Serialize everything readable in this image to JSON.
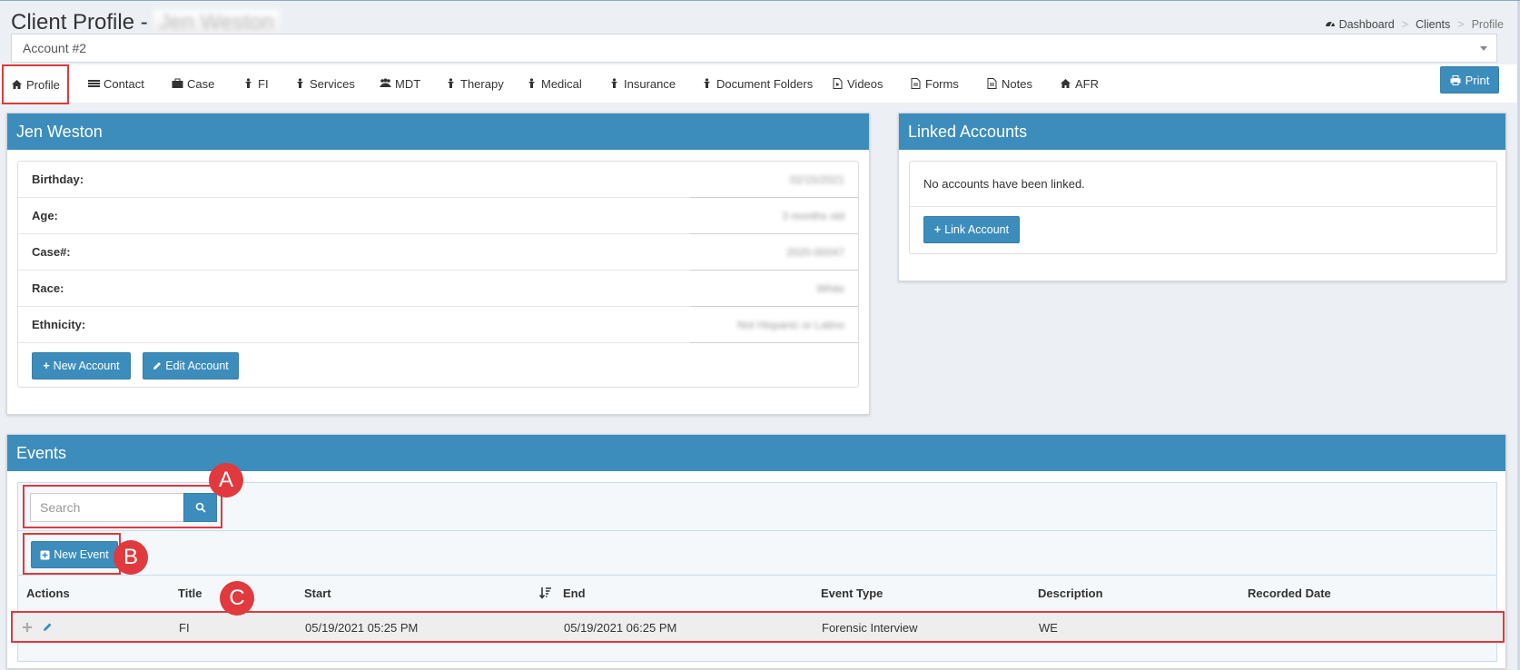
{
  "page": {
    "title": "Client Profile -",
    "title_name_blurred": "Jen Weston",
    "account_select_value": "Account #2"
  },
  "breadcrumb": {
    "items": [
      "Dashboard",
      "Clients",
      "Profile"
    ]
  },
  "tabs": [
    {
      "label": "Profile",
      "icon": "home-icon"
    },
    {
      "label": "Contact",
      "icon": "list-icon"
    },
    {
      "label": "Case",
      "icon": "briefcase-icon"
    },
    {
      "label": "FI",
      "icon": "person-icon"
    },
    {
      "label": "Services",
      "icon": "person-icon"
    },
    {
      "label": "MDT",
      "icon": "users-icon"
    },
    {
      "label": "Therapy",
      "icon": "person-icon"
    },
    {
      "label": "Medical",
      "icon": "person-icon"
    },
    {
      "label": "Insurance",
      "icon": "person-icon"
    },
    {
      "label": "Document Folders",
      "icon": "person-icon"
    },
    {
      "label": "Videos",
      "icon": "file-video-icon"
    },
    {
      "label": "Forms",
      "icon": "file-icon"
    },
    {
      "label": "Notes",
      "icon": "file-icon"
    },
    {
      "label": "AFR",
      "icon": "home-icon"
    }
  ],
  "print_label": "Print",
  "profile": {
    "header": "Jen Weston",
    "rows": [
      {
        "label": "Birthday:",
        "value": "02/15/2021"
      },
      {
        "label": "Age:",
        "value": "3 months old"
      },
      {
        "label": "Case#:",
        "value": "2020-00047"
      },
      {
        "label": "Race:",
        "value": "White"
      },
      {
        "label": "Ethnicity:",
        "value": "Not Hispanic or Latino"
      }
    ],
    "new_account_label": "New Account",
    "edit_account_label": "Edit Account"
  },
  "linked": {
    "header": "Linked Accounts",
    "message": "No accounts have been linked.",
    "link_button_label": "Link Account"
  },
  "events": {
    "header": "Events",
    "search_placeholder": "Search",
    "new_event_label": "New Event",
    "columns": [
      "Actions",
      "Title",
      "Start",
      "End",
      "Event Type",
      "Description",
      "Recorded Date"
    ],
    "rows": [
      {
        "title": "FI",
        "start": "05/19/2021 05:25 PM",
        "end": "05/19/2021 06:25 PM",
        "event_type": "Forensic Interview",
        "description": "WE",
        "recorded_date": ""
      }
    ]
  },
  "markers": [
    "A",
    "B",
    "C"
  ],
  "colors": {
    "primary": "#3c8dbc",
    "highlight": "#e0393e"
  }
}
